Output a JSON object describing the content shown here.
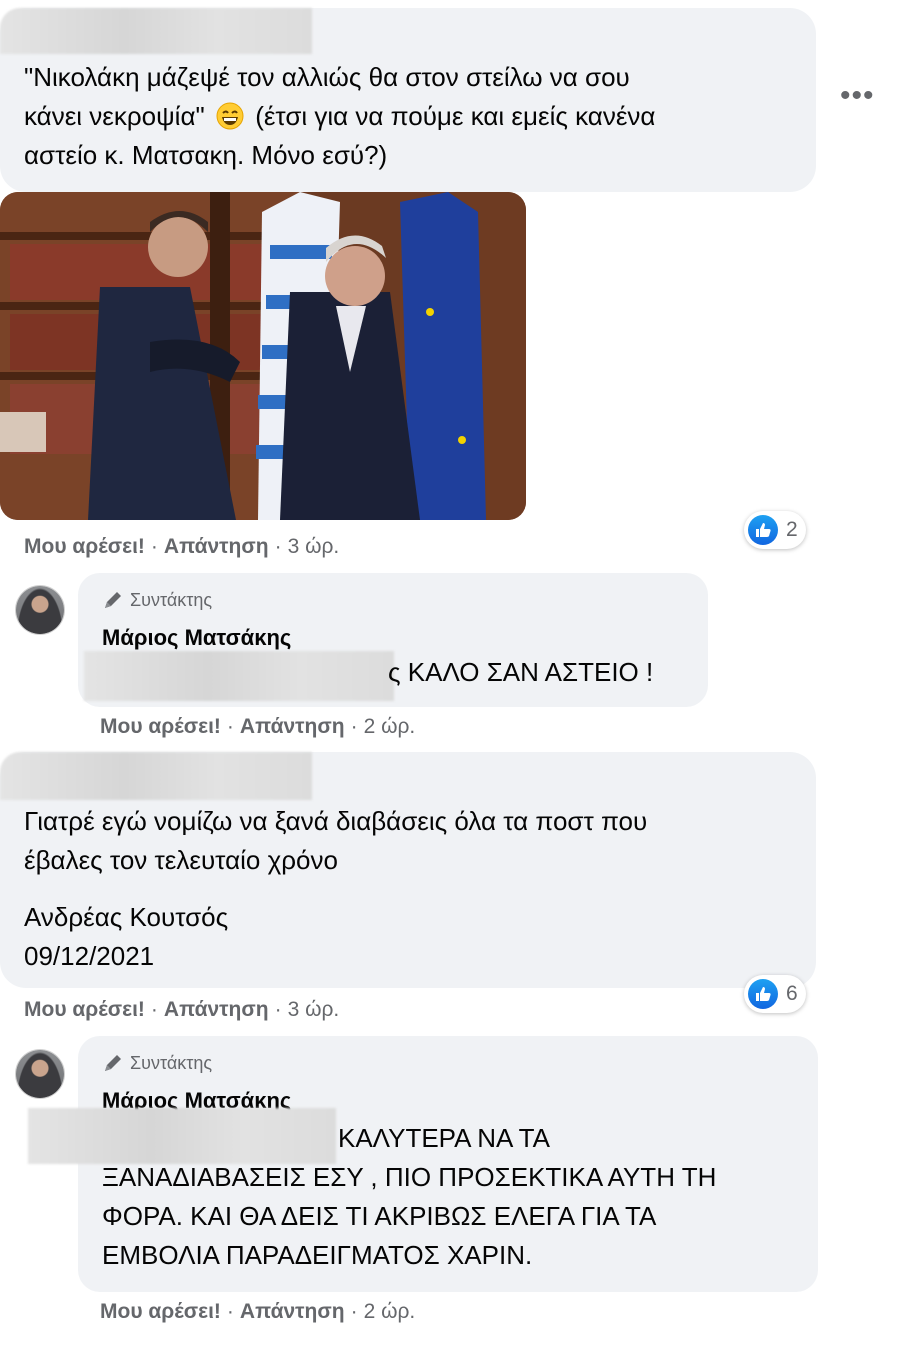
{
  "comment1": {
    "lines": [
      "\"Νικολάκη μάζεψέ τον αλλιώς θα στον στείλω να σου",
      "κάνει νεκροψία\"",
      "(έτσι για να πούμε και εμείς κανένα",
      "αστείο κ. Ματσακη. Μόνο εσύ?)"
    ],
    "emoji_icon": "grinning-face-emoji",
    "like_label": "Μου αρέσει!",
    "reply_label": "Απάντηση",
    "time": "3 ώρ.",
    "reaction_count": "2",
    "more_label": "..."
  },
  "reply1": {
    "badge": "Συντάκτης",
    "badge_icon": "pencil-icon",
    "author": "Μάριος Ματσάκης",
    "text": "ς ΚΑΛΟ ΣΑΝ ΑΣΤΕΙΟ !",
    "like_label": "Μου αρέσει!",
    "reply_label": "Απάντηση",
    "time": "2 ώρ."
  },
  "comment2": {
    "lines": [
      "Γιατρέ εγώ νομίζω να ξανά διαβάσεις όλα τα ποστ που",
      "έβαλες τον τελευταίο χρόνο",
      "Ανδρέας Κουτσός",
      "09/12/2021"
    ],
    "like_label": "Μου αρέσει!",
    "reply_label": "Απάντηση",
    "time": "3 ώρ.",
    "reaction_count": "6"
  },
  "reply2": {
    "badge": "Συντάκτης",
    "badge_icon": "pencil-icon",
    "author": "Μάριος Ματσάκης",
    "lines": [
      "ΚΑΛΥΤΕΡΑ ΝΑ ΤΑ",
      "ΞΑΝΑΔΙΑΒΑΣΕΙΣ ΕΣΥ , ΠΙΟ ΠΡΟΣΕΚΤΙΚΑ ΑΥΤΗ ΤΗ",
      "ΦΟΡΑ. ΚΑΙ ΘΑ ΔΕΙΣ ΤΙ ΑΚΡΙΒΩΣ ΕΛΕΓΑ ΓΙΑ ΤΑ",
      "ΕΜΒΟΛΙΑ ΠΑΡΑΔΕΙΓΜΑΤΟΣ ΧΑΡΙΝ."
    ],
    "like_label": "Μου αρέσει!",
    "reply_label": "Απάντηση",
    "time": "2 ώρ."
  },
  "colors": {
    "bubble": "#f0f2f5",
    "meta_text": "#65676b",
    "like_blue": "#1877f2"
  }
}
